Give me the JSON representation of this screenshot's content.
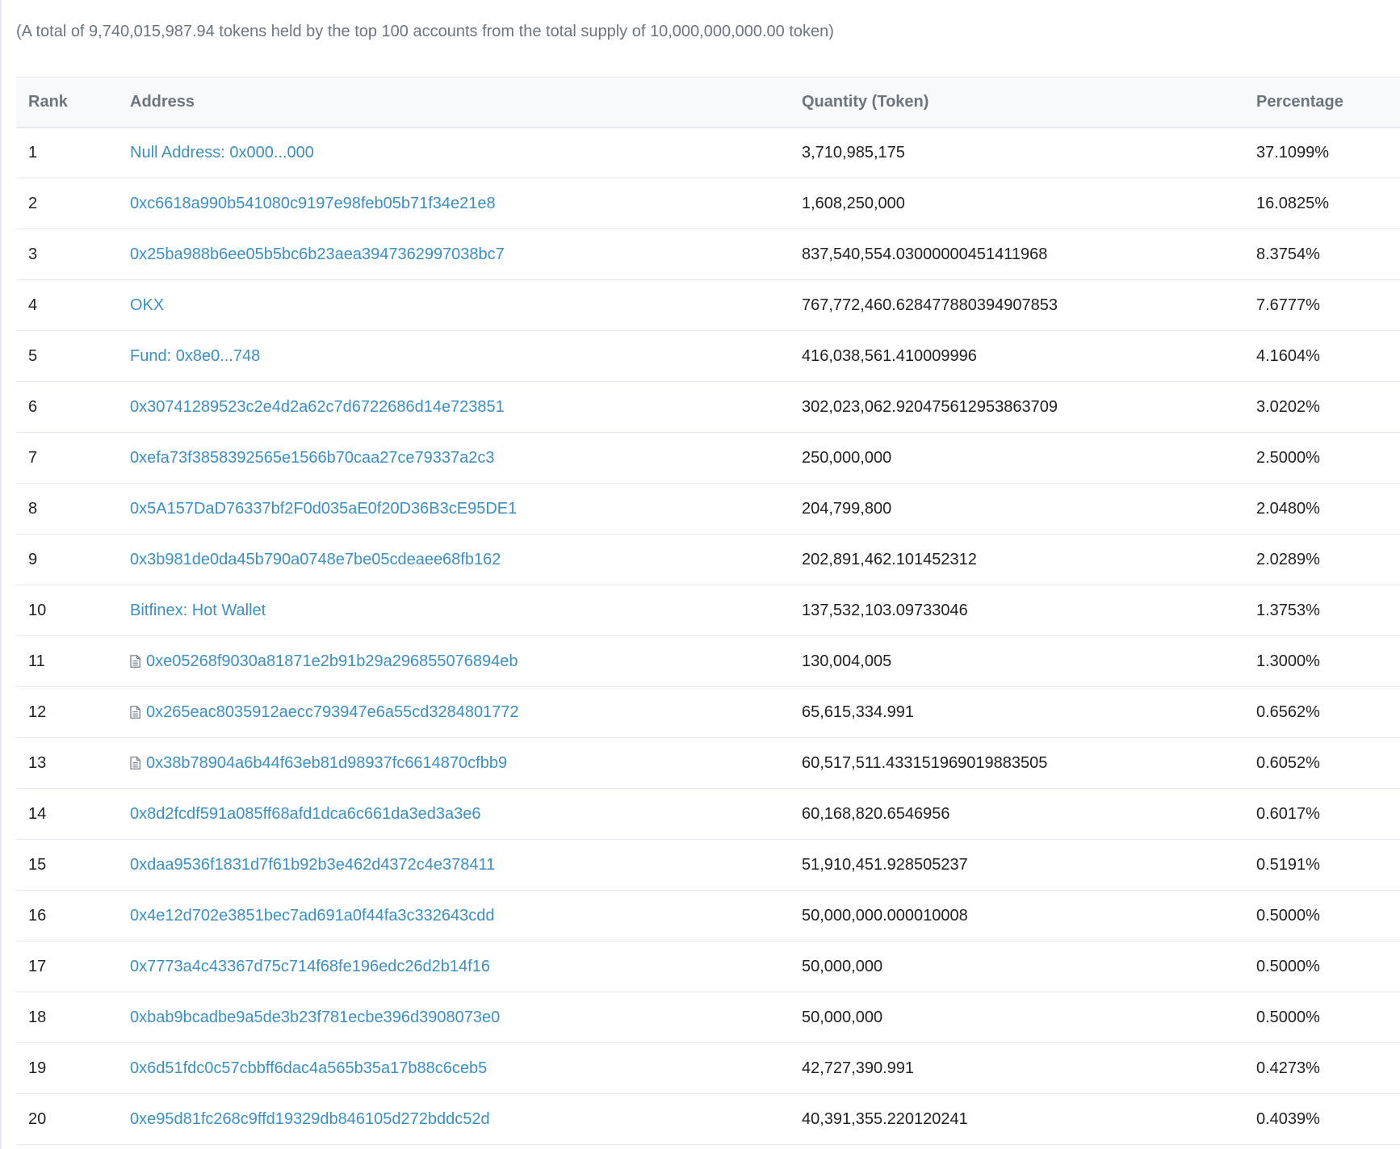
{
  "summary": "(A total of 9,740,015,987.94 tokens held by the top 100 accounts from the total supply of 10,000,000,000.00 token)",
  "table": {
    "headers": {
      "rank": "Rank",
      "address": "Address",
      "quantity": "Quantity (Token)",
      "percentage": "Percentage"
    },
    "rows": [
      {
        "rank": "1",
        "address": "Null Address: 0x000...000",
        "contract": false,
        "quantity": "3,710,985,175",
        "percentage": "37.1099%"
      },
      {
        "rank": "2",
        "address": "0xc6618a990b541080c9197e98feb05b71f34e21e8",
        "contract": false,
        "quantity": "1,608,250,000",
        "percentage": "16.0825%"
      },
      {
        "rank": "3",
        "address": "0x25ba988b6ee05b5bc6b23aea3947362997038bc7",
        "contract": false,
        "quantity": "837,540,554.03000000451411968",
        "percentage": "8.3754%"
      },
      {
        "rank": "4",
        "address": "OKX",
        "contract": false,
        "quantity": "767,772,460.628477880394907853",
        "percentage": "7.6777%"
      },
      {
        "rank": "5",
        "address": "Fund: 0x8e0...748",
        "contract": false,
        "quantity": "416,038,561.410009996",
        "percentage": "4.1604%"
      },
      {
        "rank": "6",
        "address": "0x30741289523c2e4d2a62c7d6722686d14e723851",
        "contract": false,
        "quantity": "302,023,062.920475612953863709",
        "percentage": "3.0202%"
      },
      {
        "rank": "7",
        "address": "0xefa73f3858392565e1566b70caa27ce79337a2c3",
        "contract": false,
        "quantity": "250,000,000",
        "percentage": "2.5000%"
      },
      {
        "rank": "8",
        "address": "0x5A157DaD76337bf2F0d035aE0f20D36B3cE95DE1",
        "contract": false,
        "quantity": "204,799,800",
        "percentage": "2.0480%"
      },
      {
        "rank": "9",
        "address": "0x3b981de0da45b790a0748e7be05cdeaee68fb162",
        "contract": false,
        "quantity": "202,891,462.101452312",
        "percentage": "2.0289%"
      },
      {
        "rank": "10",
        "address": "Bitfinex: Hot Wallet",
        "contract": false,
        "quantity": "137,532,103.09733046",
        "percentage": "1.3753%"
      },
      {
        "rank": "11",
        "address": "0xe05268f9030a81871e2b91b29a296855076894eb",
        "contract": true,
        "quantity": "130,004,005",
        "percentage": "1.3000%"
      },
      {
        "rank": "12",
        "address": "0x265eac8035912aecc793947e6a55cd3284801772",
        "contract": true,
        "quantity": "65,615,334.991",
        "percentage": "0.6562%"
      },
      {
        "rank": "13",
        "address": "0x38b78904a6b44f63eb81d98937fc6614870cfbb9",
        "contract": true,
        "quantity": "60,517,511.433151969019883505",
        "percentage": "0.6052%"
      },
      {
        "rank": "14",
        "address": "0x8d2fcdf591a085ff68afd1dca6c661da3ed3a3e6",
        "contract": false,
        "quantity": "60,168,820.6546956",
        "percentage": "0.6017%"
      },
      {
        "rank": "15",
        "address": "0xdaa9536f1831d7f61b92b3e462d4372c4e378411",
        "contract": false,
        "quantity": "51,910,451.928505237",
        "percentage": "0.5191%"
      },
      {
        "rank": "16",
        "address": "0x4e12d702e3851bec7ad691a0f44fa3c332643cdd",
        "contract": false,
        "quantity": "50,000,000.000010008",
        "percentage": "0.5000%"
      },
      {
        "rank": "17",
        "address": "0x7773a4c43367d75c714f68fe196edc26d2b14f16",
        "contract": false,
        "quantity": "50,000,000",
        "percentage": "0.5000%"
      },
      {
        "rank": "18",
        "address": "0xbab9bcadbe9a5de3b23f781ecbe396d3908073e0",
        "contract": false,
        "quantity": "50,000,000",
        "percentage": "0.5000%"
      },
      {
        "rank": "19",
        "address": "0x6d51fdc0c57cbbff6dac4a565b35a17b88c6ceb5",
        "contract": false,
        "quantity": "42,727,390.991",
        "percentage": "0.4273%"
      },
      {
        "rank": "20",
        "address": "0xe95d81fc268c9ffd19329db846105d272bddc52d",
        "contract": false,
        "quantity": "40,391,355.220120241",
        "percentage": "0.4039%"
      }
    ]
  },
  "icons": {
    "contract": "contract-file-icon"
  },
  "colors": {
    "link": "#3a8fc4",
    "muted_text": "#6c757e",
    "body_text": "#1e2022",
    "header_bg": "#f8f9fa",
    "border": "#e7eaf3"
  }
}
